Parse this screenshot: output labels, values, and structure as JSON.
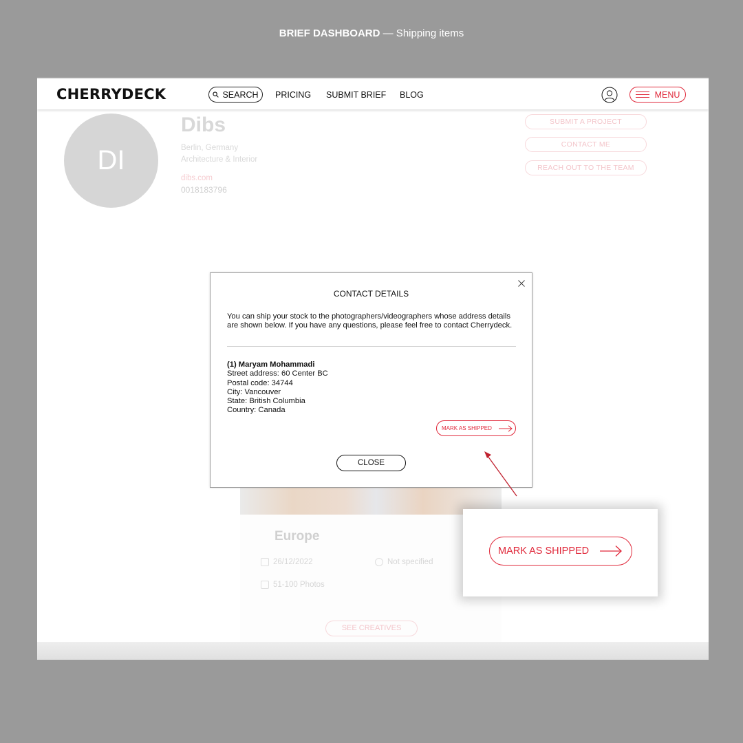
{
  "caption": {
    "title": "BRIEF DASHBOARD",
    "subtitle": "— Shipping items"
  },
  "navbar": {
    "logo": "CHERRYDECK",
    "search_label": "SEARCH",
    "links": [
      "PRICING",
      "SUBMIT BRIEF",
      "BLOG"
    ],
    "menu_label": "MENU"
  },
  "profile": {
    "initials": "DI",
    "name": "Dibs",
    "location": "Berlin, Germany",
    "category": "Architecture & Interior",
    "website": "dibs.com",
    "phone": "0018183796",
    "actions": [
      "SUBMIT A PROJECT",
      "CONTACT ME",
      "REACH OUT TO THE TEAM"
    ]
  },
  "card": {
    "region": "Europe",
    "date": "26/12/2022",
    "duration": "Not specified",
    "photos": "51-100 Photos",
    "see_creatives": "SEE CREATIVES"
  },
  "modal": {
    "title": "CONTACT DETAILS",
    "intro": "You can ship your stock to the photographers/videographers whose address details are shown below. If you have any questions, please feel free to contact Cherrydeck.",
    "recipient": {
      "name": "(1) Maryam Mohammadi",
      "street": "Street address: 60 Center BC",
      "postal": "Postal code: 34744",
      "city": "City: Vancouver",
      "state": "State: British Columbia",
      "country": "Country: Canada"
    },
    "mark_shipped_label": "MARK AS SHIPPED",
    "close_label": "CLOSE"
  },
  "zoom_callout": {
    "mark_shipped_label": "MARK AS SHIPPED"
  },
  "colors": {
    "accent": "#e0283a",
    "backdrop": "#9a9a9a"
  }
}
